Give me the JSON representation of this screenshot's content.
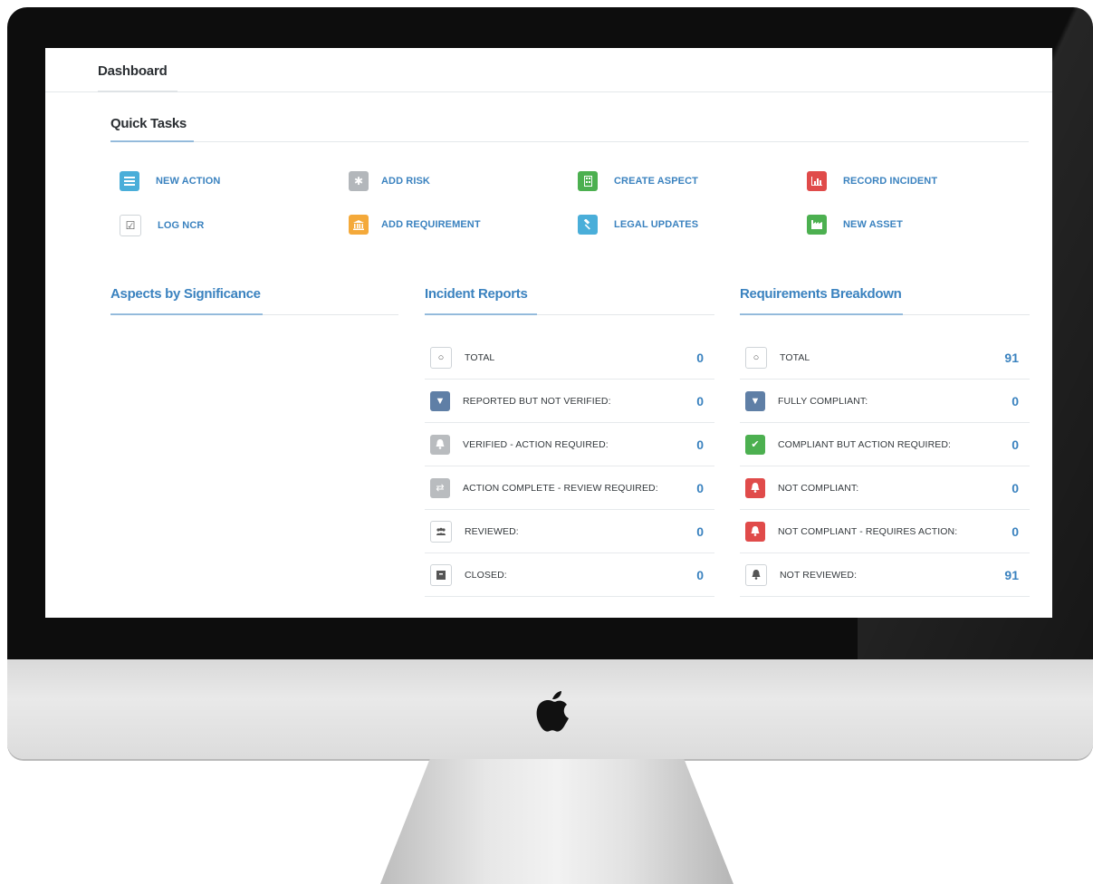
{
  "page": {
    "title": "Dashboard"
  },
  "quick_tasks": {
    "title": "Quick Tasks",
    "items": [
      {
        "label": "NEW ACTION",
        "icon": "list-icon",
        "color": "#4aaed9"
      },
      {
        "label": "ADD RISK",
        "icon": "asterisk-icon",
        "color": "#b3b7bb"
      },
      {
        "label": "CREATE ASPECT",
        "icon": "building-icon",
        "color": "#4cb050"
      },
      {
        "label": "RECORD INCIDENT",
        "icon": "bar-chart-icon",
        "color": "#e04b4a"
      },
      {
        "label": "LOG NCR",
        "icon": "checkbox-icon",
        "color": "#ffffff"
      },
      {
        "label": "ADD REQUIREMENT",
        "icon": "bank-icon",
        "color": "#f4a93a"
      },
      {
        "label": "LEGAL UPDATES",
        "icon": "gavel-icon",
        "color": "#4aaed9"
      },
      {
        "label": "NEW ASSET",
        "icon": "industry-icon",
        "color": "#4cb050"
      }
    ]
  },
  "aspects": {
    "title": "Aspects by Significance"
  },
  "incidents": {
    "title": "Incident Reports",
    "rows": [
      {
        "label": "TOTAL",
        "value": "0",
        "icon": "circle-icon",
        "color": "#ffffff"
      },
      {
        "label": "REPORTED BUT NOT VERIFIED:",
        "value": "0",
        "icon": "thumbs-down-icon",
        "color": "#5f7fa6"
      },
      {
        "label": "VERIFIED - ACTION REQUIRED:",
        "value": "0",
        "icon": "bell-icon",
        "color": "#b9bcbf"
      },
      {
        "label": "ACTION COMPLETE - REVIEW REQUIRED:",
        "value": "0",
        "icon": "exchange-icon",
        "color": "#b9bcbf"
      },
      {
        "label": "REVIEWED:",
        "value": "0",
        "icon": "users-icon",
        "color": "#ffffff"
      },
      {
        "label": "CLOSED:",
        "value": "0",
        "icon": "archive-icon",
        "color": "#ffffff"
      }
    ]
  },
  "requirements": {
    "title": "Requirements Breakdown",
    "rows": [
      {
        "label": "TOTAL",
        "value": "91",
        "icon": "circle-icon",
        "color": "#ffffff"
      },
      {
        "label": "FULLY COMPLIANT:",
        "value": "0",
        "icon": "thumbs-down-icon",
        "color": "#5f7fa6"
      },
      {
        "label": "COMPLIANT BUT ACTION REQUIRED:",
        "value": "0",
        "icon": "check-icon",
        "color": "#4cb050"
      },
      {
        "label": "NOT COMPLIANT:",
        "value": "0",
        "icon": "bell-icon",
        "color": "#e04b4a"
      },
      {
        "label": "NOT COMPLIANT - REQUIRES ACTION:",
        "value": "0",
        "icon": "bell-icon",
        "color": "#e04b4a"
      },
      {
        "label": "NOT REVIEWED:",
        "value": "91",
        "icon": "bell-icon",
        "color": "#ffffff"
      }
    ]
  }
}
